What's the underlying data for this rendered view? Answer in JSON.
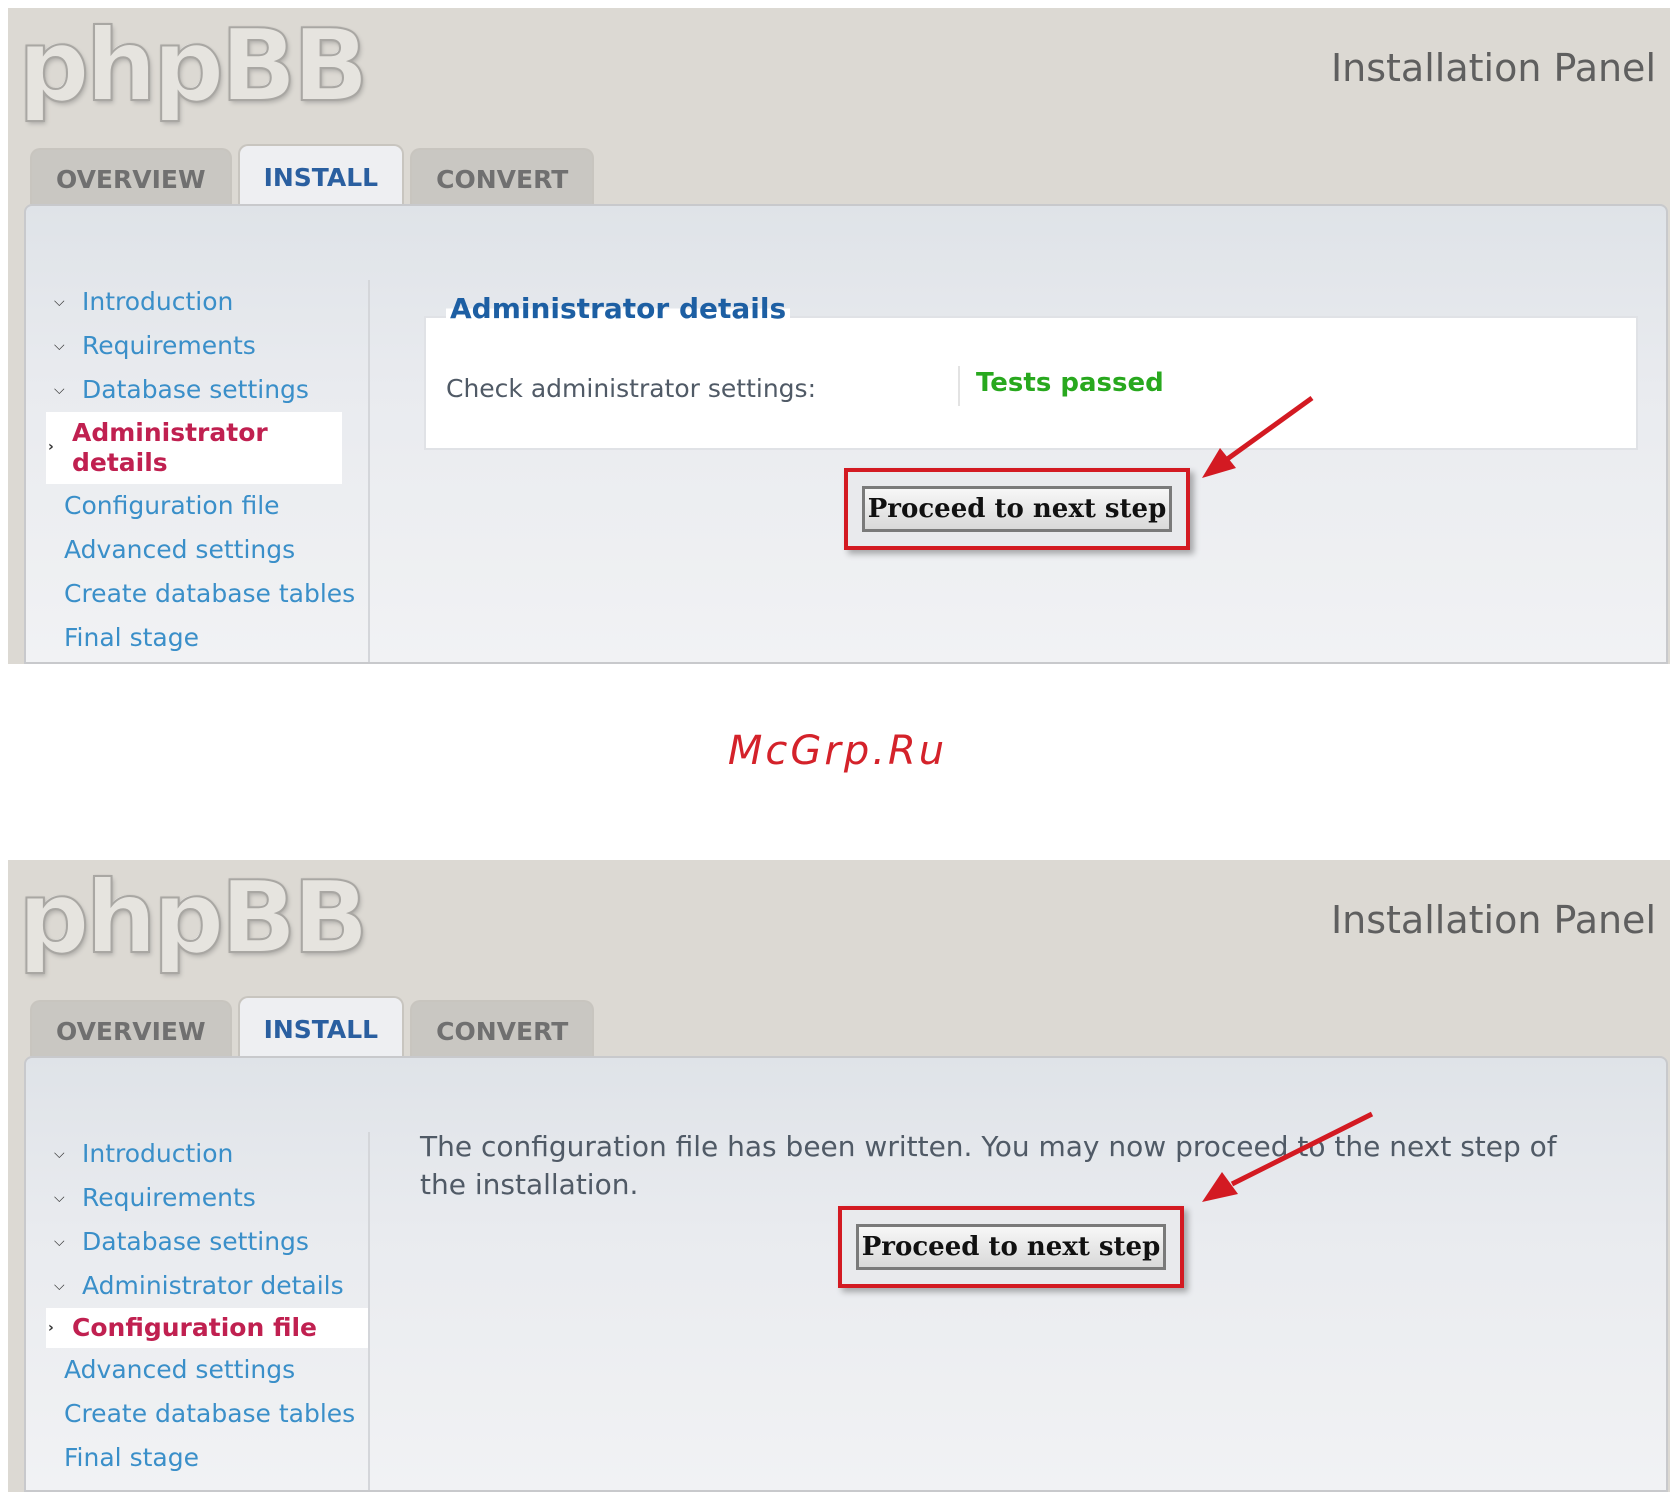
{
  "watermark": "McGrp.Ru",
  "colors": {
    "accent": "#d31a22",
    "link": "#3a8fc9",
    "current": "#c02050",
    "success": "#28a81e"
  },
  "screenshots": [
    {
      "logo": "phpBB",
      "panel_title": "Installation Panel",
      "tabs": [
        {
          "label": "OVERVIEW",
          "active": false
        },
        {
          "label": "INSTALL",
          "active": true
        },
        {
          "label": "CONVERT",
          "active": false
        }
      ],
      "nav": [
        {
          "label": "Introduction",
          "state": "done"
        },
        {
          "label": "Requirements",
          "state": "done"
        },
        {
          "label": "Database settings",
          "state": "done"
        },
        {
          "label": "Administrator details",
          "state": "current"
        },
        {
          "label": "Configuration file",
          "state": "pending"
        },
        {
          "label": "Advanced settings",
          "state": "pending"
        },
        {
          "label": "Create database tables",
          "state": "pending"
        },
        {
          "label": "Final stage",
          "state": "pending"
        }
      ],
      "fieldset": {
        "legend": "Administrator details",
        "label": "Check administrator settings:",
        "value": "Tests passed"
      },
      "button": "Proceed to next step"
    },
    {
      "logo": "phpBB",
      "panel_title": "Installation Panel",
      "tabs": [
        {
          "label": "OVERVIEW",
          "active": false
        },
        {
          "label": "INSTALL",
          "active": true
        },
        {
          "label": "CONVERT",
          "active": false
        }
      ],
      "nav": [
        {
          "label": "Introduction",
          "state": "done"
        },
        {
          "label": "Requirements",
          "state": "done"
        },
        {
          "label": "Database settings",
          "state": "done"
        },
        {
          "label": "Administrator details",
          "state": "done"
        },
        {
          "label": "Configuration file",
          "state": "current"
        },
        {
          "label": "Advanced settings",
          "state": "pending"
        },
        {
          "label": "Create database tables",
          "state": "pending"
        },
        {
          "label": "Final stage",
          "state": "pending"
        }
      ],
      "message": "The configuration file has been written. You may now proceed to the next step of the installation.",
      "button": "Proceed to next step"
    }
  ]
}
